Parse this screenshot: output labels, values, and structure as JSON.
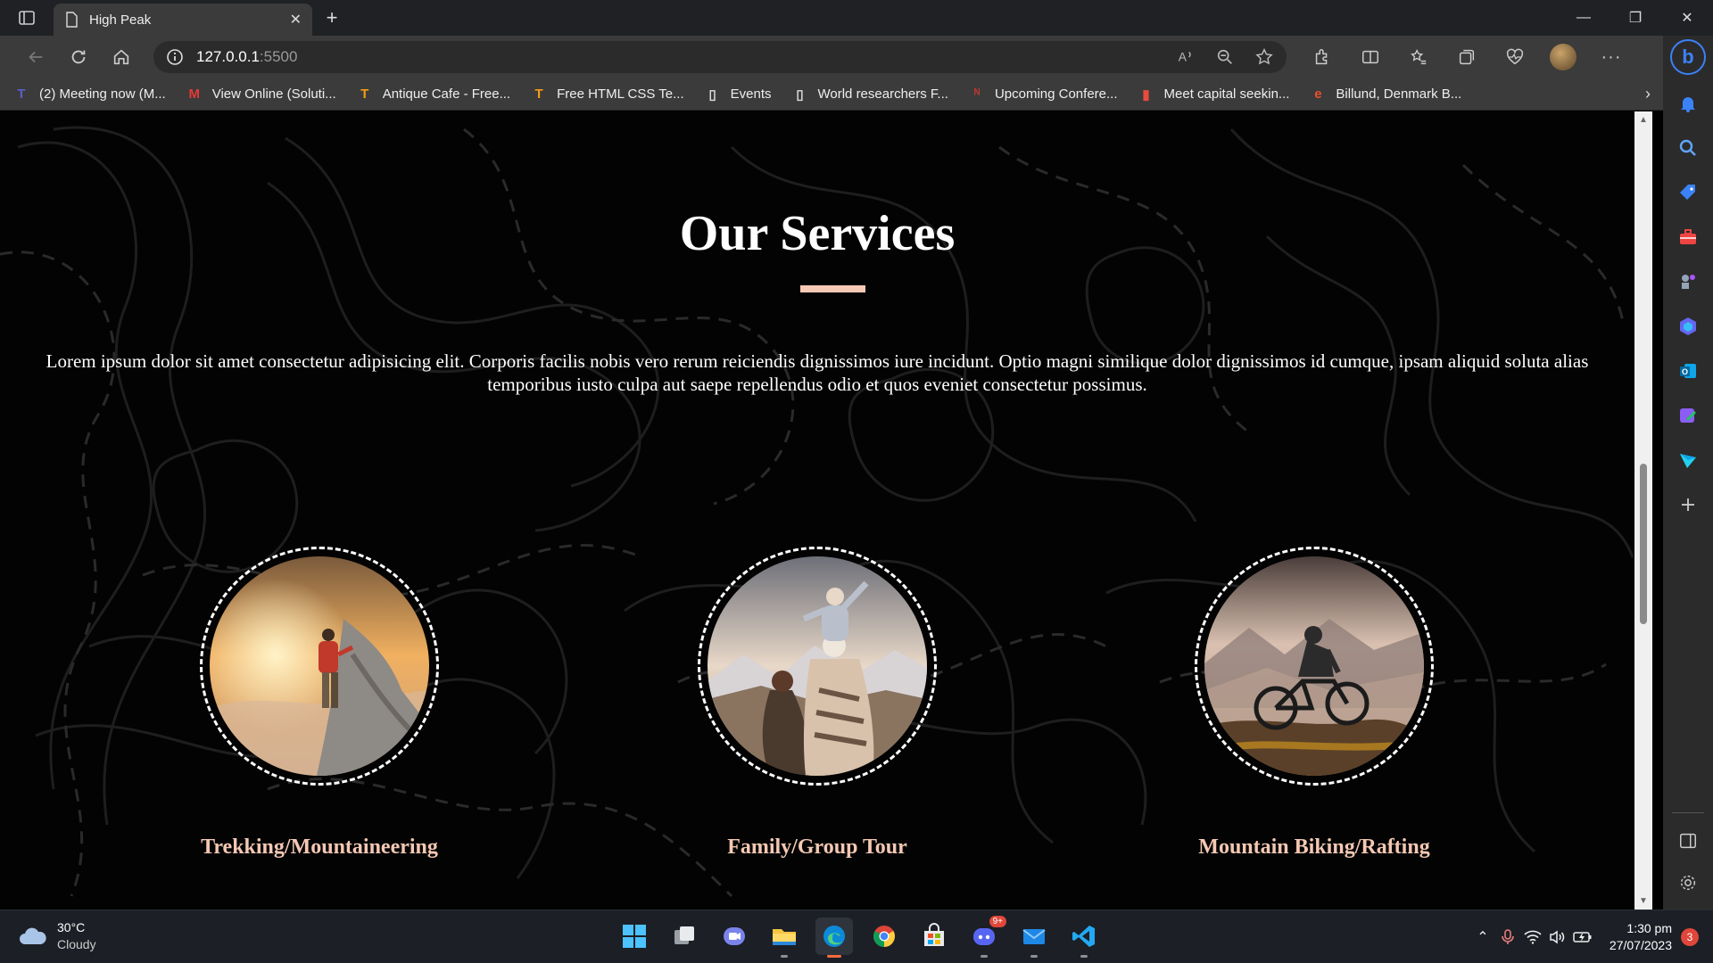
{
  "browser": {
    "tab_title": "High Peak",
    "url_host": "127.0.0.1",
    "url_port": ":5500",
    "favorites": [
      {
        "label": "(2) Meeting now (M...",
        "icon": "teams-icon",
        "color": "#5b5fc7",
        "glyph": "T"
      },
      {
        "label": "View Online (Soluti...",
        "icon": "gmail-icon",
        "color": "#e53935",
        "glyph": "M"
      },
      {
        "label": "Antique Cafe - Free...",
        "icon": "templatemo-icon",
        "color": "#f39c12",
        "glyph": "T"
      },
      {
        "label": "Free HTML CSS Te...",
        "icon": "templatemo-icon",
        "color": "#f39c12",
        "glyph": "T"
      },
      {
        "label": "Events",
        "icon": "page-icon",
        "color": "#dddddd",
        "glyph": "▯"
      },
      {
        "label": "World researchers F...",
        "icon": "page-icon",
        "color": "#dddddd",
        "glyph": "▯"
      },
      {
        "label": "Upcoming Confere...",
        "icon": "conference-icon",
        "color": "#c0392b",
        "glyph": "ᴺ"
      },
      {
        "label": "Meet capital seekin...",
        "icon": "capital-icon",
        "color": "#e74c3c",
        "glyph": "▮"
      },
      {
        "label": "Billund, Denmark B...",
        "icon": "booking-icon",
        "color": "#e8502e",
        "glyph": "e"
      }
    ]
  },
  "page": {
    "title": "Our Services",
    "description": "Lorem ipsum dolor sit amet consectetur adipisicing elit. Corporis facilis nobis vero rerum reiciendis dignissimos iure incidunt. Optio magni similique dolor dignissimos id cumque, ipsam aliquid soluta alias temporibus iusto culpa aut saepe repellendus odio et quos eveniet consectetur possimus.",
    "accent_color": "#f4c8b3",
    "services": [
      {
        "label": "Trekking/Mountaineering"
      },
      {
        "label": "Family/Group Tour"
      },
      {
        "label": "Mountain Biking/Rafting"
      }
    ]
  },
  "taskbar": {
    "weather_temp": "30°C",
    "weather_desc": "Cloudy",
    "time": "1:30 pm",
    "date": "27/07/2023",
    "notification_count": "3",
    "discord_badge": "9+"
  }
}
